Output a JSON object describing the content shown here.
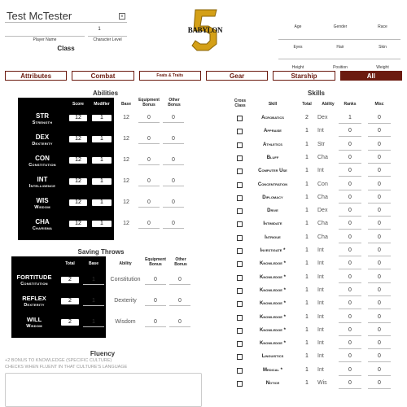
{
  "header": {
    "name": "Test McTester",
    "level": "1",
    "player_name_label": "Player Name",
    "char_level_label": "Character Level",
    "class_label": "Class",
    "logo_text": "BABYLON",
    "logo_number": "5",
    "info_top": [
      "Age",
      "Gender",
      "Race"
    ],
    "info_mid": [
      "Eyes",
      "Hair",
      "Skin"
    ],
    "info_bot": [
      "Height",
      "Position",
      "Weight"
    ]
  },
  "tabs": [
    "Attributes",
    "Combat",
    "Feats & Traits",
    "Gear",
    "Starship",
    "All"
  ],
  "abilities": {
    "title": "Abilities",
    "cols": [
      "Score",
      "Modifier",
      "Base",
      "Equipment Bonus",
      "Other Bonus"
    ],
    "rows": [
      {
        "abbr": "STR",
        "name": "Strength",
        "score": "12",
        "mod": "1",
        "base": "12",
        "equip": "0",
        "other": "0"
      },
      {
        "abbr": "DEX",
        "name": "Dexterity",
        "score": "12",
        "mod": "1",
        "base": "12",
        "equip": "0",
        "other": "0"
      },
      {
        "abbr": "CON",
        "name": "Constitution",
        "score": "12",
        "mod": "1",
        "base": "12",
        "equip": "0",
        "other": "0"
      },
      {
        "abbr": "INT",
        "name": "Intelligence",
        "score": "12",
        "mod": "1",
        "base": "12",
        "equip": "0",
        "other": "0"
      },
      {
        "abbr": "WIS",
        "name": "Wisdom",
        "score": "12",
        "mod": "1",
        "base": "12",
        "equip": "0",
        "other": "0"
      },
      {
        "abbr": "CHA",
        "name": "Charisma",
        "score": "12",
        "mod": "1",
        "base": "12",
        "equip": "0",
        "other": "0"
      }
    ]
  },
  "saves": {
    "title": "Saving Throws",
    "cols": [
      "Total",
      "Base",
      "Ability",
      "Equipment Bonus",
      "Other Bonus"
    ],
    "rows": [
      {
        "main": "FORTITUDE",
        "sub": "Constitution",
        "total": "2",
        "base": "1",
        "ability": "Constitution",
        "equip": "0",
        "other": "0"
      },
      {
        "main": "REFLEX",
        "sub": "Dexterity",
        "total": "2",
        "base": "1",
        "ability": "Dexterity",
        "equip": "0",
        "other": "0"
      },
      {
        "main": "WILL",
        "sub": "Wisdom",
        "total": "2",
        "base": "1",
        "ability": "Wisdom",
        "equip": "0",
        "other": "0"
      }
    ]
  },
  "fluency": {
    "title": "Fluency",
    "line1": "+2 BONUS TO KNOWLEDGE (SPECIFIC CULTURE)",
    "line2": "CHECKS WHEN FLUENT IN THAT CULTURE'S LANGUAGE"
  },
  "skills": {
    "title": "Skills",
    "cols": [
      "Cross Class",
      "Skill",
      "Total",
      "Ability",
      "Ranks",
      "Misc"
    ],
    "rows": [
      {
        "name": "Acrobatics",
        "total": "2",
        "ability": "Dex",
        "ranks": "1",
        "misc": "0"
      },
      {
        "name": "Appraise",
        "total": "1",
        "ability": "Int",
        "ranks": "0",
        "misc": "0"
      },
      {
        "name": "Athletics",
        "total": "1",
        "ability": "Str",
        "ranks": "0",
        "misc": "0"
      },
      {
        "name": "Bluff",
        "total": "1",
        "ability": "Cha",
        "ranks": "0",
        "misc": "0"
      },
      {
        "name": "Computer Use",
        "total": "1",
        "ability": "Int",
        "ranks": "0",
        "misc": "0"
      },
      {
        "name": "Concentration",
        "total": "1",
        "ability": "Con",
        "ranks": "0",
        "misc": "0"
      },
      {
        "name": "Diplomacy",
        "total": "1",
        "ability": "Cha",
        "ranks": "0",
        "misc": "0"
      },
      {
        "name": "Drive",
        "total": "1",
        "ability": "Dex",
        "ranks": "0",
        "misc": "0"
      },
      {
        "name": "Intimidate",
        "total": "1",
        "ability": "Cha",
        "ranks": "0",
        "misc": "0"
      },
      {
        "name": "Intrigue",
        "total": "1",
        "ability": "Cha",
        "ranks": "0",
        "misc": "0"
      },
      {
        "name": "Investigate *",
        "total": "1",
        "ability": "Int",
        "ranks": "0",
        "misc": "0"
      },
      {
        "name": "Knowledge *",
        "total": "1",
        "ability": "Int",
        "ranks": "0",
        "misc": "0"
      },
      {
        "name": "Knowledge *",
        "total": "1",
        "ability": "Int",
        "ranks": "0",
        "misc": "0"
      },
      {
        "name": "Knowledge *",
        "total": "1",
        "ability": "Int",
        "ranks": "0",
        "misc": "0"
      },
      {
        "name": "Knowledge *",
        "total": "1",
        "ability": "Int",
        "ranks": "0",
        "misc": "0"
      },
      {
        "name": "Knowledge *",
        "total": "1",
        "ability": "Int",
        "ranks": "0",
        "misc": "0"
      },
      {
        "name": "Knowledge *",
        "total": "1",
        "ability": "Int",
        "ranks": "0",
        "misc": "0"
      },
      {
        "name": "Knowledge *",
        "total": "1",
        "ability": "Int",
        "ranks": "0",
        "misc": "0"
      },
      {
        "name": "Linguistics",
        "total": "1",
        "ability": "Int",
        "ranks": "0",
        "misc": "0"
      },
      {
        "name": "Medical *",
        "total": "1",
        "ability": "Int",
        "ranks": "0",
        "misc": "0"
      },
      {
        "name": "Notice",
        "total": "1",
        "ability": "Wis",
        "ranks": "0",
        "misc": "0"
      }
    ]
  },
  "colors": {
    "accent": "#6b1a0f",
    "logo_gold": "#d4a017",
    "panel": "#000000"
  }
}
